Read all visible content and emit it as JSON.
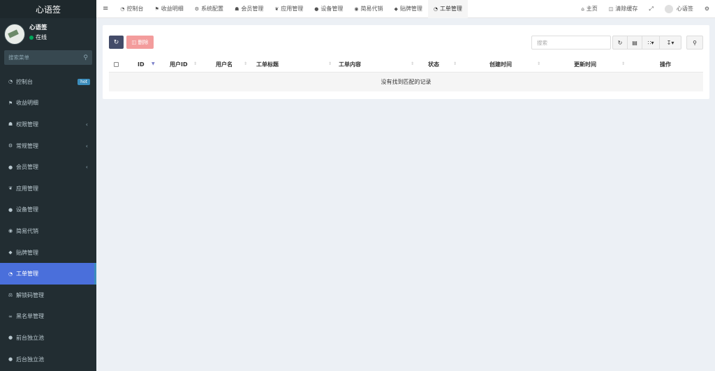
{
  "app": {
    "logo": "心语签"
  },
  "user": {
    "name": "心语签",
    "status": "在线"
  },
  "sidebar": {
    "search_placeholder": "搜索菜单",
    "items": [
      {
        "label": "控制台",
        "icon": "dashboard-icon",
        "badge": "hot"
      },
      {
        "label": "收益明细",
        "icon": "flag-icon"
      },
      {
        "label": "权限管理",
        "icon": "group-icon",
        "arrow": "‹"
      },
      {
        "label": "常规管理",
        "icon": "cogs-icon",
        "arrow": "‹"
      },
      {
        "label": "会员管理",
        "icon": "user-circle-icon",
        "arrow": "‹"
      },
      {
        "label": "应用管理",
        "icon": "leaf-icon"
      },
      {
        "label": "设备管理",
        "icon": "circle-icon"
      },
      {
        "label": "简易代销",
        "icon": "globe-icon"
      },
      {
        "label": "贴牌管理",
        "icon": "tags-icon"
      },
      {
        "label": "工单管理",
        "icon": "dashboard-icon",
        "active": true
      },
      {
        "label": "解锁码管理",
        "icon": "balance-icon"
      },
      {
        "label": "黑名单管理",
        "icon": "bicycle-icon"
      },
      {
        "label": "前台独立池",
        "icon": "question-icon"
      },
      {
        "label": "后台独立池",
        "icon": "apple-icon"
      }
    ]
  },
  "topbar": {
    "tabs": [
      {
        "label": "控制台",
        "icon": "dashboard-icon"
      },
      {
        "label": "收益明细",
        "icon": "flag-icon"
      },
      {
        "label": "系统配置",
        "icon": "cogs-icon"
      },
      {
        "label": "会员管理",
        "icon": "group-icon"
      },
      {
        "label": "应用管理",
        "icon": "leaf-icon"
      },
      {
        "label": "设备管理",
        "icon": "circle-icon"
      },
      {
        "label": "简易代销",
        "icon": "globe-icon"
      },
      {
        "label": "贴牌管理",
        "icon": "tags-icon"
      },
      {
        "label": "工单管理",
        "icon": "dashboard-icon",
        "active": true
      }
    ],
    "home_label": "主页",
    "clear_cache_label": "清除缓存",
    "username": "心语签"
  },
  "toolbar": {
    "delete_label": "删除",
    "search_placeholder": "搜索"
  },
  "table": {
    "columns": [
      "ID",
      "用户ID",
      "用户名",
      "工单标题",
      "工单内容",
      "状态",
      "创建时间",
      "更新时间",
      "操作"
    ],
    "empty_text": "没有找到匹配的记录"
  },
  "colors": {
    "sidebar_bg": "#222d32",
    "active_menu": "#4a6fdb",
    "primary_btn": "#444c69",
    "danger_btn": "#f39c9c"
  }
}
